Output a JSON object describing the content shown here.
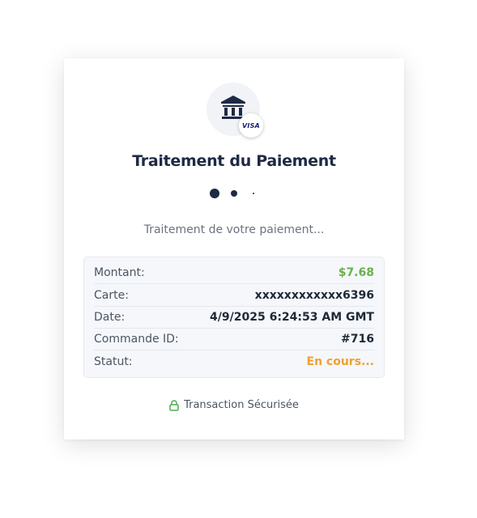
{
  "header": {
    "bank_icon": "bank-icon",
    "card_brand": "VISA"
  },
  "title": "Traitement du Paiement",
  "status_message": "Traitement de votre paiement...",
  "details": {
    "rows": [
      {
        "label": "Montant:",
        "value": "$7.68"
      },
      {
        "label": "Carte:",
        "value": "xxxxxxxxxxxx6396"
      },
      {
        "label": "Date:",
        "value": "4/9/2025 6:24:53 AM GMT"
      },
      {
        "label": "Commande ID:",
        "value": "#716"
      },
      {
        "label": "Statut:",
        "value": "En cours..."
      }
    ]
  },
  "footer": {
    "lock_icon": "lock-icon",
    "secure_text": "Transaction Sécurisée"
  },
  "colors": {
    "primary": "#1e2a44",
    "amount": "#6ab04c",
    "pending": "#f0a030",
    "secure_icon": "#4caf50",
    "visa": "#1a1f71"
  }
}
